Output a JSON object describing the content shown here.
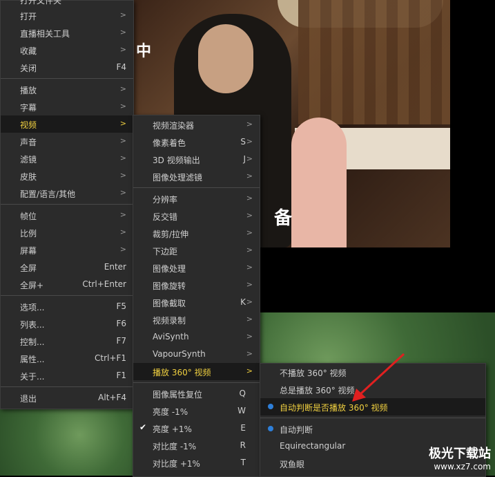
{
  "video": {
    "subtitle_fragment": "中",
    "subtitle_fragment2": "备"
  },
  "watermark": {
    "title": "极光下载站",
    "url": "www.xz7.com"
  },
  "main_menu": {
    "partial_top": "打开文件夹",
    "items": [
      {
        "label": "打开",
        "shortcut": "",
        "arrow": ">"
      },
      {
        "label": "直播相关工具",
        "shortcut": "",
        "arrow": ">"
      },
      {
        "label": "收藏",
        "shortcut": "",
        "arrow": ">"
      },
      {
        "label": "关闭",
        "shortcut": "F4",
        "arrow": ""
      },
      {
        "label": "播放",
        "shortcut": "",
        "arrow": ">"
      },
      {
        "label": "字幕",
        "shortcut": "",
        "arrow": ">"
      },
      {
        "label": "视频",
        "shortcut": "",
        "arrow": ">"
      },
      {
        "label": "声音",
        "shortcut": "",
        "arrow": ">"
      },
      {
        "label": "滤镜",
        "shortcut": "",
        "arrow": ">"
      },
      {
        "label": "皮肤",
        "shortcut": "",
        "arrow": ">"
      },
      {
        "label": "配置/语言/其他",
        "shortcut": "",
        "arrow": ">"
      },
      {
        "label": "帧位",
        "shortcut": "",
        "arrow": ">"
      },
      {
        "label": "比例",
        "shortcut": "",
        "arrow": ">"
      },
      {
        "label": "屏幕",
        "shortcut": "",
        "arrow": ">"
      },
      {
        "label": "全屏",
        "shortcut": "Enter",
        "arrow": ""
      },
      {
        "label": "全屏+",
        "shortcut": "Ctrl+Enter",
        "arrow": ""
      },
      {
        "label": "选项...",
        "shortcut": "F5",
        "arrow": ""
      },
      {
        "label": "列表...",
        "shortcut": "F6",
        "arrow": ""
      },
      {
        "label": "控制...",
        "shortcut": "F7",
        "arrow": ""
      },
      {
        "label": "属性...",
        "shortcut": "Ctrl+F1",
        "arrow": ""
      },
      {
        "label": "关于...",
        "shortcut": "F1",
        "arrow": ""
      },
      {
        "label": "退出",
        "shortcut": "Alt+F4",
        "arrow": ""
      }
    ]
  },
  "video_menu": {
    "items": [
      {
        "label": "视频渲染器",
        "shortcut": "",
        "arrow": ">"
      },
      {
        "label": "像素着色",
        "shortcut": "S",
        "arrow": ">"
      },
      {
        "label": "3D 视频输出",
        "shortcut": "J",
        "arrow": ">"
      },
      {
        "label": "图像处理滤镜",
        "shortcut": "",
        "arrow": ">"
      },
      {
        "label": "分辨率",
        "shortcut": "",
        "arrow": ">"
      },
      {
        "label": "反交错",
        "shortcut": "",
        "arrow": ">"
      },
      {
        "label": "裁剪/拉伸",
        "shortcut": "",
        "arrow": ">"
      },
      {
        "label": "下边距",
        "shortcut": "",
        "arrow": ">"
      },
      {
        "label": "图像处理",
        "shortcut": "",
        "arrow": ">"
      },
      {
        "label": "图像旋转",
        "shortcut": "",
        "arrow": ">"
      },
      {
        "label": "图像截取",
        "shortcut": "K",
        "arrow": ">"
      },
      {
        "label": "视频录制",
        "shortcut": "",
        "arrow": ">"
      },
      {
        "label": "AviSynth",
        "shortcut": "",
        "arrow": ">"
      },
      {
        "label": "VapourSynth",
        "shortcut": "",
        "arrow": ">"
      },
      {
        "label": "播放 360° 视频",
        "shortcut": "",
        "arrow": ">"
      },
      {
        "label": "图像属性复位",
        "shortcut": "Q",
        "arrow": ""
      },
      {
        "label": "亮度 -1%",
        "shortcut": "W",
        "arrow": ""
      },
      {
        "label": "亮度 +1%",
        "shortcut": "E",
        "arrow": ""
      },
      {
        "label": "对比度 -1%",
        "shortcut": "R",
        "arrow": ""
      },
      {
        "label": "对比度 +1%",
        "shortcut": "T",
        "arrow": ""
      }
    ]
  },
  "vr_menu": {
    "items": [
      {
        "label": "不播放 360° 视频"
      },
      {
        "label": "总是播放 360° 视频"
      },
      {
        "label": "自动判断是否播放 360° 视频"
      },
      {
        "label": "自动判断"
      },
      {
        "label": "Equirectangular"
      },
      {
        "label": "双鱼眼"
      }
    ]
  },
  "colors": {
    "highlight_text": "#f0d040",
    "menu_bg": "#2b2b2b",
    "radio": "#2e7fd9",
    "arrow": "#e02020"
  }
}
